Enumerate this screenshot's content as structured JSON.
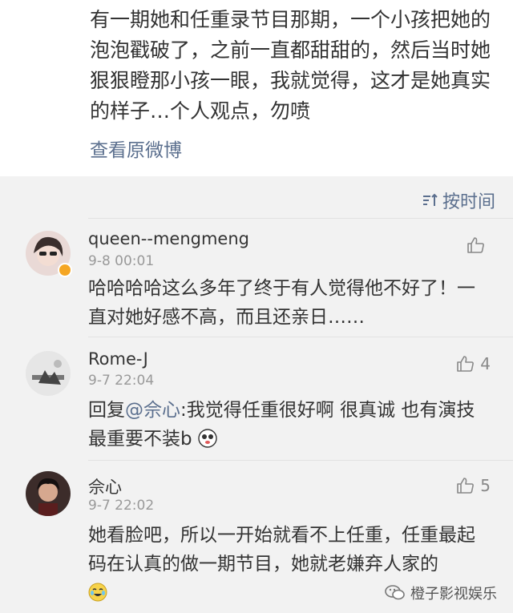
{
  "post": {
    "text": "有一期她和任重录节目那期，一个小孩把她的泡泡戳破了，之前一直都甜甜的，然后当时她狠狠瞪那小孩一眼，我就觉得，这才是她真实的样子…个人观点，勿喷",
    "view_original": "查看原微博"
  },
  "sort": {
    "label": "按时间"
  },
  "comments": [
    {
      "username": "queen--mengmeng",
      "time": "9-8 00:01",
      "text": "哈哈哈哈这么多年了终于有人觉得他不好了！一直对她好感不高，而且还亲日……",
      "likes": "",
      "verified": true
    },
    {
      "username": "Rome-J",
      "time": "9-7 22:04",
      "reply_prefix": "回复",
      "mention": "@佘心",
      "text": ":我觉得任重很好啊 很真诚 也有演技最重要不装b",
      "likes": "4"
    },
    {
      "username": "佘心",
      "time": "9-7 22:02",
      "text": "她看脸吧，所以一开始就看不上任重，任重最起码在认真的做一期节目，她就老嫌弃人家的",
      "likes": "5"
    }
  ],
  "watermark": {
    "text": "橙子影视娱乐"
  },
  "colors": {
    "link": "#5b6f8e",
    "badge": "#f5a623",
    "meta": "#999999"
  },
  "icons": {
    "sort": "sort-icon",
    "like": "thumbs-up-icon",
    "wechat": "wechat-icon"
  }
}
